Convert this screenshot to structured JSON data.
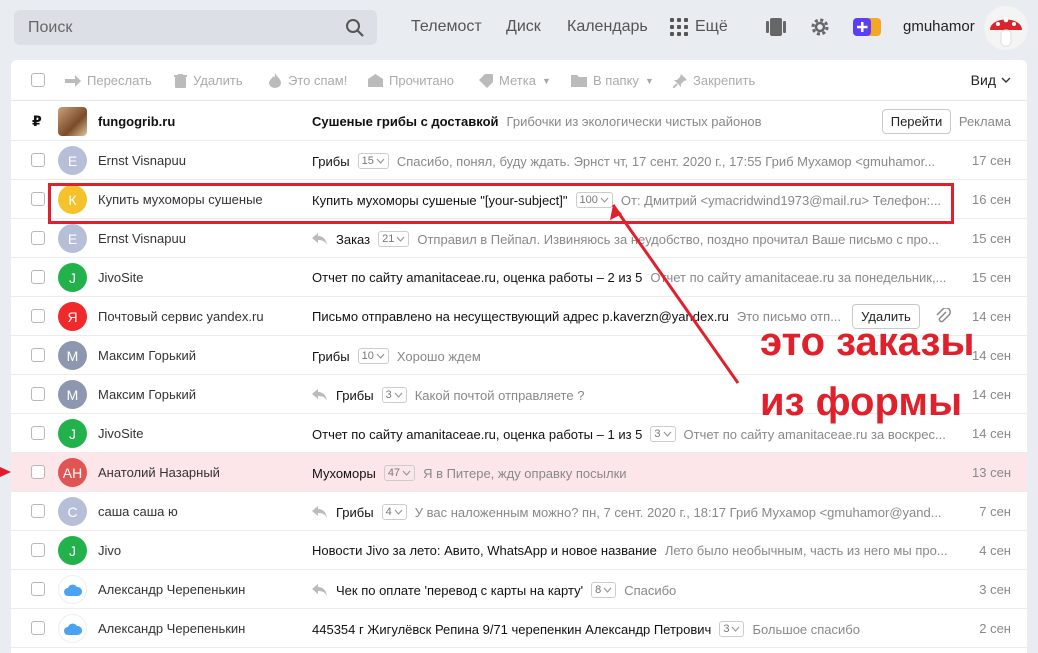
{
  "header": {
    "search_placeholder": "Поиск",
    "nav": [
      "Телемост",
      "Диск",
      "Календарь"
    ],
    "more_label": "Ещё",
    "username": "gmuhamor"
  },
  "toolbar": {
    "forward": "Переслать",
    "delete": "Удалить",
    "spam": "Это спам!",
    "read": "Прочитано",
    "label": "Метка",
    "folder": "В папку",
    "pin": "Закрепить",
    "view": "Вид"
  },
  "ad": {
    "currency": "₽",
    "sender": "fungogrib.ru",
    "subject": "Сушеные грибы с доставкой",
    "snippet": "Грибочки из экологически чистых районов",
    "button": "Перейти",
    "tag": "Реклама"
  },
  "messages": [
    {
      "initial": "E",
      "color": "#b7bfd8",
      "sender": "Ernst Visnapuu",
      "subject": "Грибы",
      "count": "15",
      "reply": false,
      "snippet": "Спасибо, понял, буду ждать. Эрнст чт, 17 сент. 2020 г., 17:55 Гриб Мухамор <gmuhamor...",
      "date": "17 сен"
    },
    {
      "initial": "К",
      "color": "#f5c22c",
      "sender": "Купить мухоморы сушеные",
      "subject": "Купить мухоморы сушеные \"[your-subject]\"",
      "count": "100",
      "reply": false,
      "snippet": "От: Дмитрий <ymacridwind1973@mail.ru> Телефон:...",
      "date": "16 сен"
    },
    {
      "initial": "E",
      "color": "#b7bfd8",
      "sender": "Ernst Visnapuu",
      "subject": "Заказ",
      "count": "21",
      "reply": true,
      "snippet": "Отправил в Пейпал. Извиняюсь за неудобство, поздно прочитал Ваше письмо с про...",
      "date": "15 сен"
    },
    {
      "initial": "J",
      "color": "#21b24b",
      "sender": "JivoSite",
      "subject": "Отчет по сайту amanitaceae.ru, оценка работы – 2 из 5",
      "count": "",
      "reply": false,
      "snippet": "Отчет по сайту amanitaceae.ru за понедельник,...",
      "date": "15 сен"
    },
    {
      "initial": "Я",
      "color": "#f0292b",
      "sender": "Почтовый сервис yandex.ru",
      "subject": "Письмо отправлено на несуществующий адрес p.kaverzn@yandex.ru",
      "count": "",
      "reply": false,
      "snippet": "Это письмо отп...",
      "date": "14 сен",
      "button": "Удалить"
    },
    {
      "initial": "М",
      "color": "#8e97b0",
      "sender": "Максим Горький",
      "subject": "Грибы",
      "count": "10",
      "reply": false,
      "snippet": "Хорошо ждем",
      "date": "14 сен"
    },
    {
      "initial": "М",
      "color": "#8e97b0",
      "sender": "Максим Горький",
      "subject": "Грибы",
      "count": "3",
      "reply": true,
      "snippet": "Какой почтой отправляете ?",
      "date": "14 сен"
    },
    {
      "initial": "J",
      "color": "#21b24b",
      "sender": "JivoSite",
      "subject": "Отчет по сайту amanitaceae.ru, оценка работы – 1 из 5",
      "count": "3",
      "reply": false,
      "snippet": "Отчет по сайту amanitaceae.ru за воскрес...",
      "date": "14 сен"
    },
    {
      "initial": "АН",
      "color": "#e05454",
      "sender": "Анатолий Назарный",
      "subject": "Мухоморы",
      "count": "47",
      "reply": false,
      "snippet": "Я в Питере, жду оправку посылки",
      "date": "13 сен",
      "flagged": true
    },
    {
      "initial": "С",
      "color": "#b7bfd8",
      "sender": "саша саша ю",
      "subject": "Грибы",
      "count": "4",
      "reply": true,
      "snippet": "У вас наложенным можно? пн, 7 сент. 2020 г., 18:17 Гриб Мухамор <gmuhamor@yand...",
      "date": "7 сен"
    },
    {
      "initial": "J",
      "color": "#21b24b",
      "sender": "Jivo",
      "subject": "Новости Jivo за лето: Авито, WhatsApp и новое название",
      "count": "",
      "reply": false,
      "snippet": "Лето было необычным, часть из него мы про...",
      "date": "4 сен"
    },
    {
      "initial": "",
      "color": "#ffffff",
      "sender": "Александр Черепенькин",
      "subject": "Чек по оплате 'перевод с карты на карту'",
      "count": "8",
      "reply": true,
      "snippet": "Спасибо",
      "date": "3 сен",
      "cloud": true
    },
    {
      "initial": "",
      "color": "#ffffff",
      "sender": "Александр Черепенькин",
      "subject": "445354 г Жигулёвск Репина 9/71 черепенкин Александр Петрович",
      "count": "3",
      "reply": false,
      "snippet": "Большое спасибо",
      "date": "2 сен",
      "cloud": true
    }
  ],
  "annotation": {
    "line1": "это заказы",
    "line2": "из формы"
  }
}
